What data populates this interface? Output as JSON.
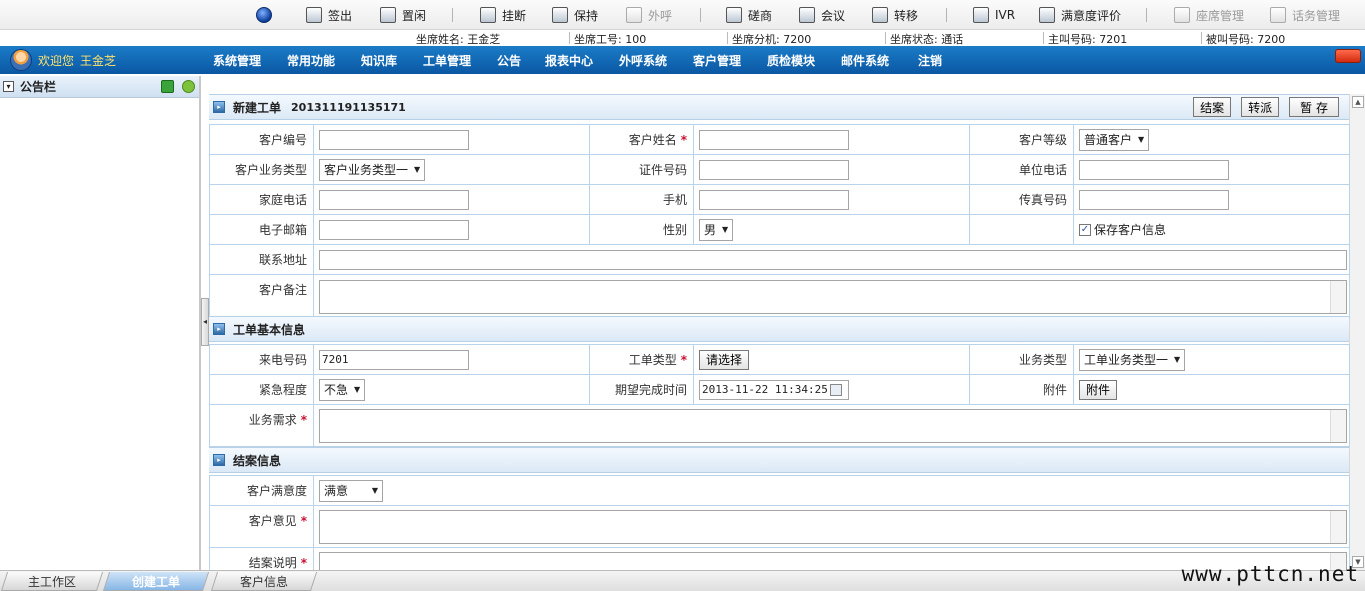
{
  "toolbar": {
    "signout": "签出",
    "idle": "置闲",
    "hangup": "挂断",
    "hold": "保持",
    "outcall": "外呼",
    "consult": "磋商",
    "meeting": "会议",
    "transfer": "转移",
    "ivr": "IVR",
    "satisfaction": "满意度评价",
    "seat_mgmt": "座席管理",
    "call_mgmt": "话务管理"
  },
  "status": {
    "agent_name": "坐席姓名: 王金芝",
    "agent_id": "坐席工号: 100",
    "extension": "坐席分机: 7200",
    "state": "坐席状态: 通话",
    "caller": "主叫号码: 7201",
    "callee": "被叫号码: 7200"
  },
  "nav": {
    "welcome": "欢迎您",
    "user": "王金芝",
    "items": [
      "系统管理",
      "常用功能",
      "知识库",
      "工单管理",
      "公告",
      "报表中心",
      "外呼系统",
      "客户管理",
      "质检模块",
      "邮件系统",
      "注销"
    ]
  },
  "left": {
    "title": "公告栏",
    "toggle": "▾"
  },
  "ticket": {
    "title": "新建工单",
    "number": "201311191135171",
    "buttons": {
      "close": "结案",
      "transfer": "转派",
      "save": "暂 存"
    },
    "labels": {
      "cust_no": "客户编号",
      "cust_name": "客户姓名",
      "cust_level": "客户等级",
      "biz_type": "客户业务类型",
      "id_no": "证件号码",
      "work_phone": "单位电话",
      "home_phone": "家庭电话",
      "mobile": "手机",
      "fax": "传真号码",
      "email": "电子邮箱",
      "gender": "性别",
      "save_cust": "保存客户信息",
      "address": "联系地址",
      "remark": "客户备注"
    },
    "values": {
      "cust_level": "普通客户",
      "biz_type": "客户业务类型一",
      "gender": "男"
    }
  },
  "basic": {
    "title": "工单基本信息",
    "labels": {
      "caller_no": "来电号码",
      "ticket_type": "工单类型",
      "biz_type": "业务类型",
      "urgency": "紧急程度",
      "expected_time": "期望完成时间",
      "attach": "附件",
      "requirement": "业务需求"
    },
    "values": {
      "caller_no": "7201",
      "ticket_type_btn": "请选择",
      "biz_type": "工单业务类型一",
      "urgency": "不急",
      "expected_time": "2013-11-22 11:34:25",
      "attach_btn": "附件"
    }
  },
  "closing": {
    "title": "结案信息",
    "labels": {
      "satisfaction": "客户满意度",
      "opinion": "客户意见",
      "explain": "结案说明"
    },
    "values": {
      "satisfaction": "满意"
    }
  },
  "tabs": [
    "主工作区",
    "创建工单",
    "客户信息"
  ],
  "watermark": "www.pttcn.net",
  "colors": {
    "nav": "#0a57a3",
    "accent": "#2f6aa5",
    "required": "#c8102e"
  }
}
